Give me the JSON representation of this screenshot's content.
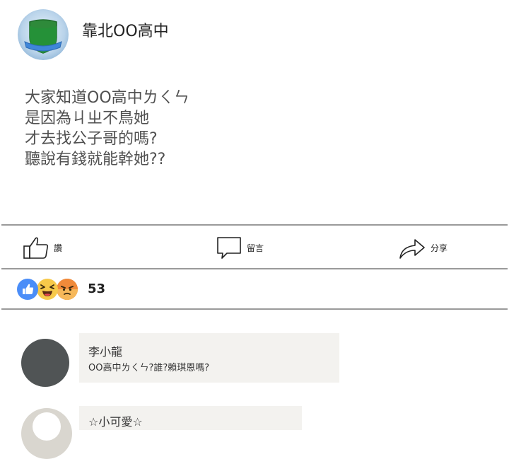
{
  "post": {
    "page_name": "靠北OO高中",
    "lines": [
      "大家知道OO高中ㄌㄑㄣ",
      "是因為ㄐㄓ不鳥她",
      "才去找公子哥的嗎?",
      "聽說有錢就能幹她??"
    ]
  },
  "actions": {
    "like_label": "讚",
    "comment_label": "留言",
    "share_label": "分享"
  },
  "reactions": {
    "types": [
      "like",
      "haha",
      "angry"
    ],
    "count": "53",
    "colors": {
      "like": "#4a8df8",
      "haha": "#f7c94a",
      "angry": "#f08a3a"
    }
  },
  "comments": [
    {
      "name": "李小龍",
      "text": "OO高中ㄌㄑㄣ?誰?賴琪恩嗎?"
    },
    {
      "name": "☆小可愛☆",
      "text": ""
    }
  ]
}
